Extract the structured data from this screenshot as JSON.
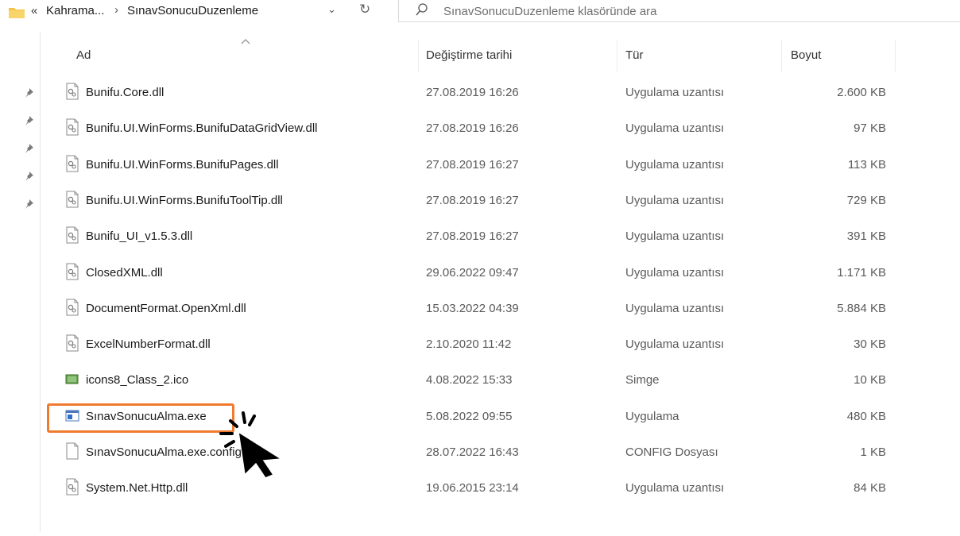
{
  "address": {
    "overflow_glyph": "«",
    "segment_parent": "Kahrama...",
    "separator": "›",
    "segment_current": "SınavSonucuDuzenleme",
    "dropdown_glyph": "⌄",
    "refresh_glyph": "↻"
  },
  "search": {
    "placeholder": "SınavSonucuDuzenleme klasöründe ara"
  },
  "columns": {
    "name": "Ad",
    "date": "Değiştirme tarihi",
    "type": "Tür",
    "size": "Boyut"
  },
  "files": [
    {
      "name": "Bunifu.Core.dll",
      "date": "27.08.2019 16:26",
      "type": "Uygulama uzantısı",
      "size": "2.600 KB",
      "icon": "dll-file-icon"
    },
    {
      "name": "Bunifu.UI.WinForms.BunifuDataGridView.dll",
      "date": "27.08.2019 16:26",
      "type": "Uygulama uzantısı",
      "size": "97 KB",
      "icon": "dll-file-icon"
    },
    {
      "name": "Bunifu.UI.WinForms.BunifuPages.dll",
      "date": "27.08.2019 16:27",
      "type": "Uygulama uzantısı",
      "size": "113 KB",
      "icon": "dll-file-icon"
    },
    {
      "name": "Bunifu.UI.WinForms.BunifuToolTip.dll",
      "date": "27.08.2019 16:27",
      "type": "Uygulama uzantısı",
      "size": "729 KB",
      "icon": "dll-file-icon"
    },
    {
      "name": "Bunifu_UI_v1.5.3.dll",
      "date": "27.08.2019 16:27",
      "type": "Uygulama uzantısı",
      "size": "391 KB",
      "icon": "dll-file-icon"
    },
    {
      "name": "ClosedXML.dll",
      "date": "29.06.2022 09:47",
      "type": "Uygulama uzantısı",
      "size": "1.171 KB",
      "icon": "dll-file-icon"
    },
    {
      "name": "DocumentFormat.OpenXml.dll",
      "date": "15.03.2022 04:39",
      "type": "Uygulama uzantısı",
      "size": "5.884 KB",
      "icon": "dll-file-icon"
    },
    {
      "name": "ExcelNumberFormat.dll",
      "date": "2.10.2020 11:42",
      "type": "Uygulama uzantısı",
      "size": "30 KB",
      "icon": "dll-file-icon"
    },
    {
      "name": "icons8_Class_2.ico",
      "date": "4.08.2022 15:33",
      "type": "Simge",
      "size": "10 KB",
      "icon": "ico-file-icon"
    },
    {
      "name": "SınavSonucuAlma.exe",
      "date": "5.08.2022 09:55",
      "type": "Uygulama",
      "size": "480 KB",
      "icon": "exe-file-icon"
    },
    {
      "name": "SınavSonucuAlma.exe.config",
      "date": "28.07.2022 16:43",
      "type": "CONFIG Dosyası",
      "size": "1 KB",
      "icon": "config-file-icon"
    },
    {
      "name": "System.Net.Http.dll",
      "date": "19.06.2015 23:14",
      "type": "Uygulama uzantısı",
      "size": "84 KB",
      "icon": "dll-file-icon"
    }
  ],
  "colors": {
    "highlight": "#f07a2d",
    "folder": "#f5c344"
  }
}
